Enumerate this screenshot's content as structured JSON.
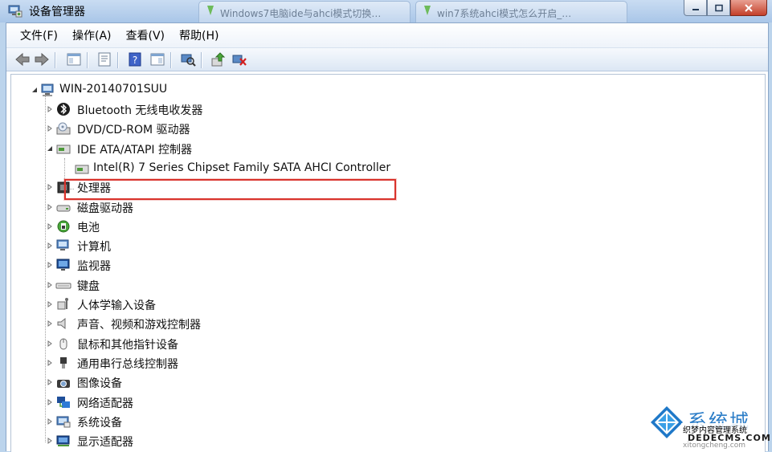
{
  "window": {
    "title": "设备管理器",
    "background_tabs": [
      "Windows7电脑ide与ahci模式切换…",
      "win7系统ahci模式怎么开启_…"
    ]
  },
  "menu": [
    {
      "label": "文件(F)"
    },
    {
      "label": "操作(A)"
    },
    {
      "label": "查看(V)"
    },
    {
      "label": "帮助(H)"
    }
  ],
  "toolbar": {
    "buttons": [
      "back-icon",
      "forward-icon",
      "show-hide-console-tree-icon",
      "properties-icon",
      "help-icon",
      "action-pane-icon",
      "scan-hardware-icon",
      "update-driver-icon",
      "uninstall-icon"
    ]
  },
  "tree": {
    "root": {
      "label": "WIN-20140701SUU",
      "expanded": true
    },
    "categories": [
      {
        "label": "Bluetooth 无线电收发器",
        "icon": "bluetooth-icon",
        "expanded": false
      },
      {
        "label": "DVD/CD-ROM 驱动器",
        "icon": "dvd-drive-icon",
        "expanded": false
      },
      {
        "label": "IDE ATA/ATAPI 控制器",
        "icon": "ide-controller-icon",
        "expanded": true,
        "children": [
          {
            "label": "Intel(R) 7 Series Chipset Family SATA AHCI Controller",
            "icon": "controller-device-icon",
            "selected": true
          }
        ]
      },
      {
        "label": "处理器",
        "icon": "processor-icon",
        "expanded": false
      },
      {
        "label": "磁盘驱动器",
        "icon": "disk-drive-icon",
        "expanded": false
      },
      {
        "label": "电池",
        "icon": "battery-icon",
        "expanded": false
      },
      {
        "label": "计算机",
        "icon": "computer-icon",
        "expanded": false
      },
      {
        "label": "监视器",
        "icon": "monitor-icon",
        "expanded": false
      },
      {
        "label": "键盘",
        "icon": "keyboard-icon",
        "expanded": false
      },
      {
        "label": "人体学输入设备",
        "icon": "hid-icon",
        "expanded": false
      },
      {
        "label": "声音、视频和游戏控制器",
        "icon": "sound-icon",
        "expanded": false
      },
      {
        "label": "鼠标和其他指针设备",
        "icon": "mouse-icon",
        "expanded": false
      },
      {
        "label": "通用串行总线控制器",
        "icon": "usb-icon",
        "expanded": false
      },
      {
        "label": "图像设备",
        "icon": "camera-icon",
        "expanded": false
      },
      {
        "label": "网络适配器",
        "icon": "network-adapter-icon",
        "expanded": false
      },
      {
        "label": "系统设备",
        "icon": "system-device-icon",
        "expanded": false
      },
      {
        "label": "显示适配器",
        "icon": "display-adapter-icon",
        "expanded": false
      }
    ]
  },
  "watermark": {
    "title": "系统城",
    "site_name": "织梦内容管理系统",
    "domain": "DEDECMS.COM",
    "pinyin": "xitongcheng.com"
  },
  "colors": {
    "selection_outline": "#d9332c",
    "accent": "#2a7cc7"
  }
}
